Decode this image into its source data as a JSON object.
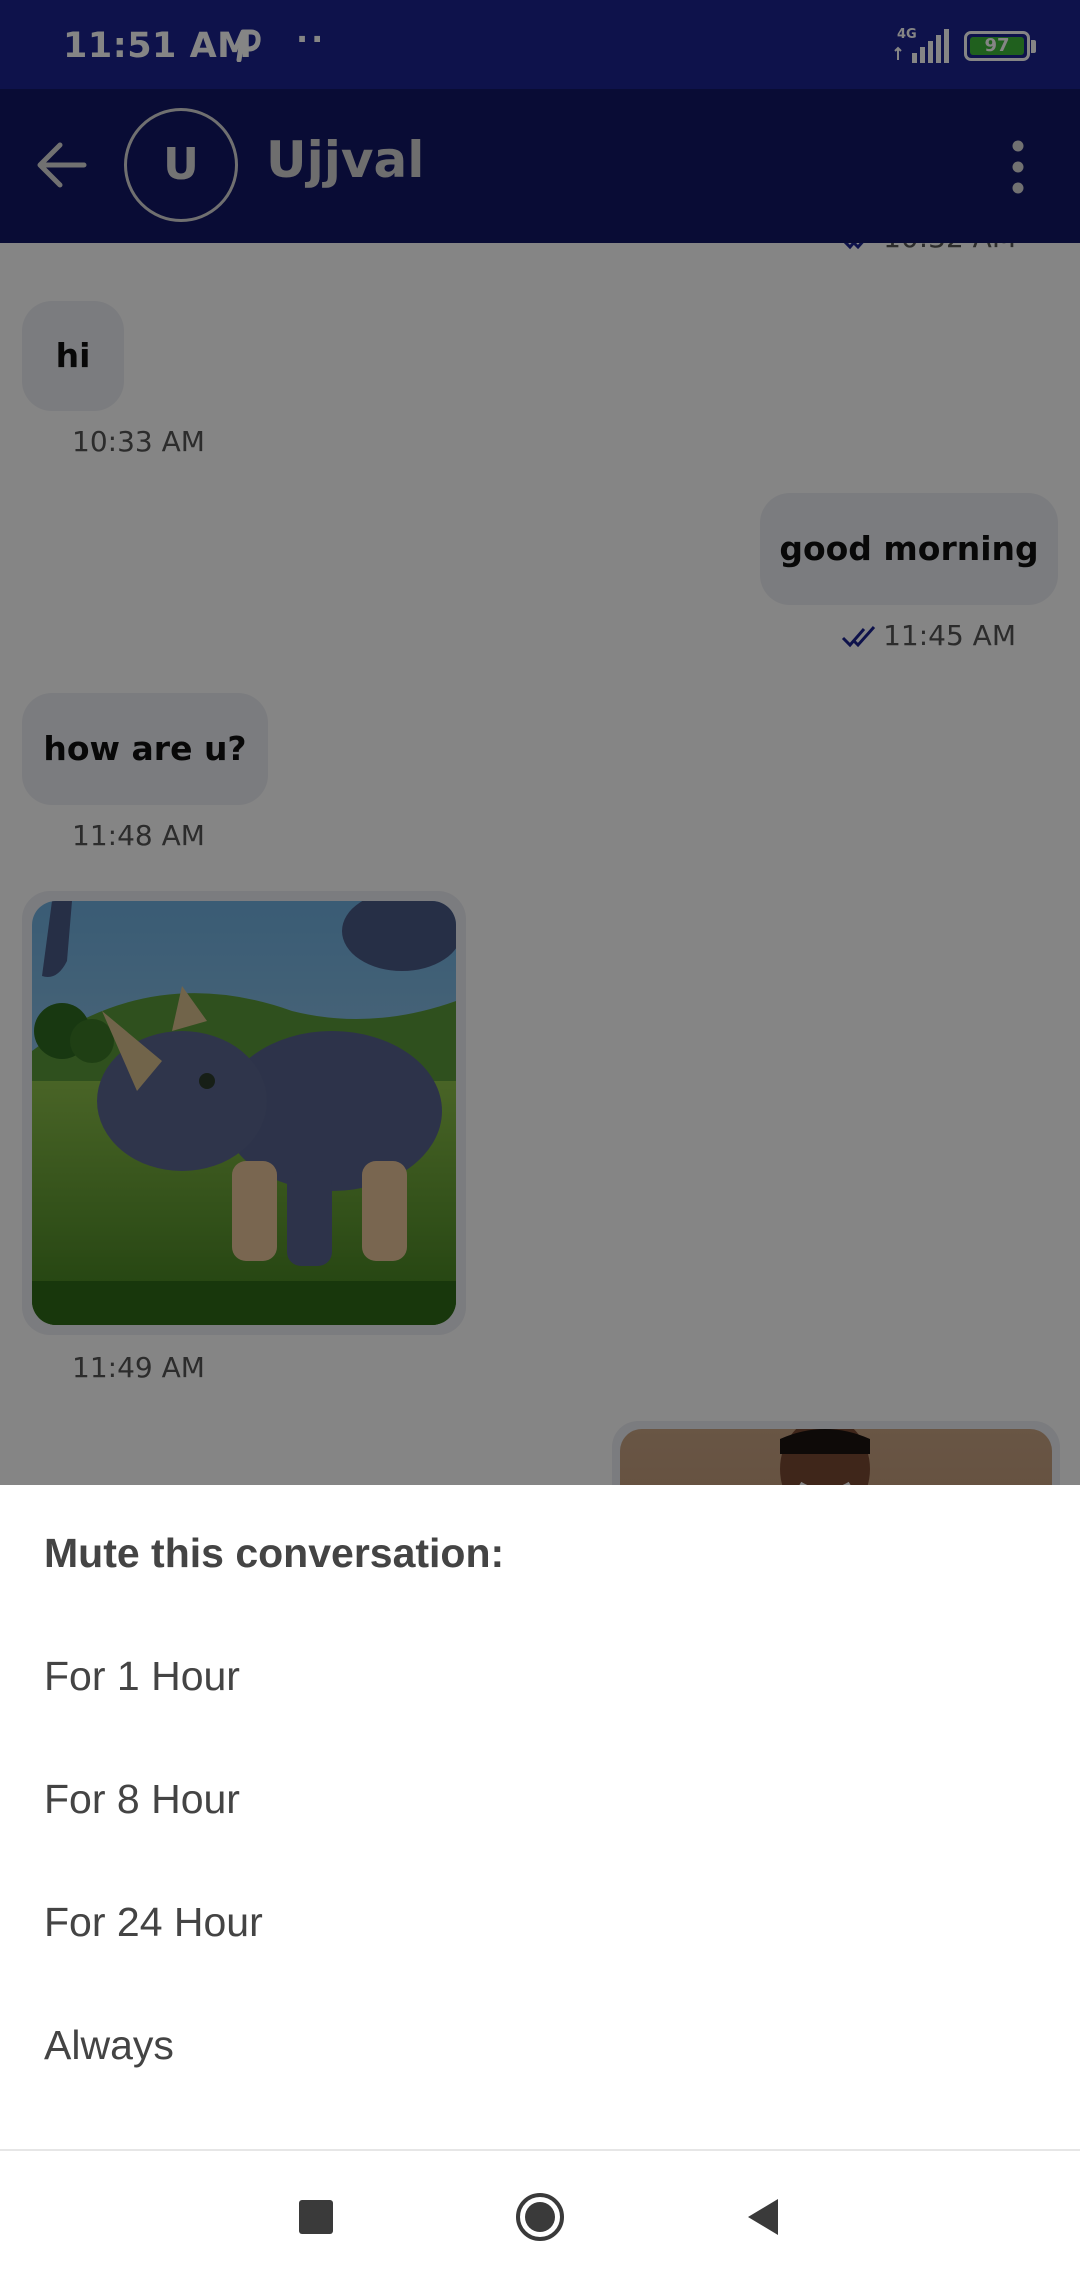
{
  "status_bar": {
    "time": "11:51 AM",
    "network_label": "4G",
    "battery": "97",
    "colors": {
      "background": "#1c2490",
      "battery_fill": "#3fb83a"
    }
  },
  "header": {
    "avatar_initial": "U",
    "contact_name": "Ujjval",
    "colors": {
      "background": "#131867"
    }
  },
  "messages": [
    {
      "side": "out",
      "time": "10:32 AM",
      "read": true
    },
    {
      "side": "in",
      "text": "hi",
      "time": "10:33 AM"
    },
    {
      "side": "out",
      "text": "good morning",
      "time": "11:45 AM",
      "read": true
    },
    {
      "side": "in",
      "text": "how are u?",
      "time": "11:48 AM"
    },
    {
      "side": "in",
      "type": "image",
      "subject": "cartoon rhino",
      "time": "11:49 AM"
    },
    {
      "side": "out",
      "type": "image",
      "subject": "photo of a person"
    }
  ],
  "mute_sheet": {
    "title": "Mute this conversation:",
    "options": [
      "For 1 Hour",
      "For 8 Hour",
      "For 24 Hour",
      "Always"
    ]
  },
  "nav": {
    "icons": [
      "recents-square-icon",
      "home-circle-icon",
      "back-triangle-icon"
    ]
  }
}
